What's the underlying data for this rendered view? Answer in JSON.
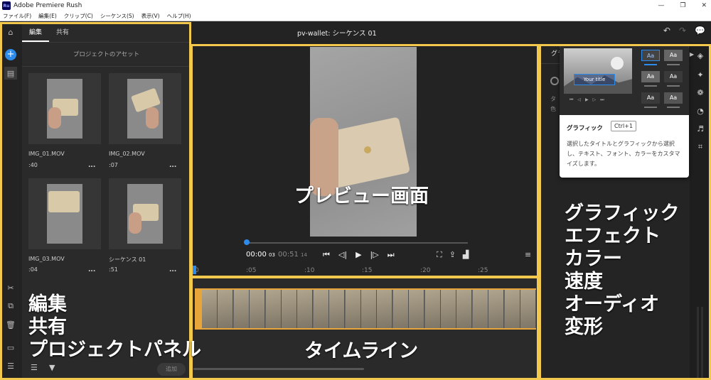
{
  "window": {
    "title": "Adobe Premiere Rush",
    "app_badge": "Ru"
  },
  "menu": [
    "ファイル(F)",
    "編集(E)",
    "クリップ(C)",
    "シーケンス(S)",
    "表示(V)",
    "ヘルプ(H)"
  ],
  "left_panel": {
    "tabs": [
      "編集",
      "共有"
    ],
    "assets_title": "プロジェクトのアセット",
    "assets": [
      {
        "name": "IMG_01.MOV",
        "duration": ":40"
      },
      {
        "name": "IMG_02.MOV",
        "duration": ":07"
      },
      {
        "name": "IMG_03.MOV",
        "duration": ":04"
      },
      {
        "name": "シーケンス 01",
        "duration": ":51"
      }
    ],
    "more_label": "...",
    "add_button": "追加"
  },
  "header": {
    "title": "pv-wallet: シーケンス 01"
  },
  "preview": {
    "current_time": "00:00",
    "current_frames": "03",
    "total_time": "00:51",
    "total_frames": "14",
    "progress": 0.0
  },
  "ruler": {
    "marks": [
      "0",
      ":05",
      ":10",
      ":15",
      ":20",
      ":25"
    ]
  },
  "right_panel": {
    "tab_label": "グラ",
    "side_text_1": "タ",
    "side_text_2": "色"
  },
  "tooltip": {
    "preview_title": "Your title",
    "name": "グラフィック",
    "shortcut": "Ctrl+1",
    "description": "選択したタイトルとグラフィックから選択し、テキスト、フォント、カラーをカスタマイズします。",
    "aa_labels": [
      "Aa",
      "Aa",
      "Aa",
      "Aa",
      "Aa",
      "Aa"
    ]
  },
  "annotations": {
    "preview": "プレビュー画面",
    "timeline": "タイムライン",
    "left": [
      "編集",
      "共有",
      "プロジェクトパネル"
    ],
    "right": [
      "グラフィック",
      "エフェクト",
      "カラー",
      "速度",
      "オーディオ",
      "変形"
    ]
  },
  "colors": {
    "highlight": "#f2c94c",
    "accent": "#2d8ceb",
    "clip": "#e8a53a"
  }
}
